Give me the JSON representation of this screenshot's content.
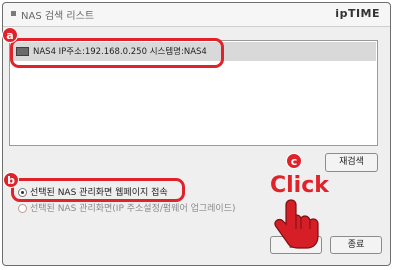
{
  "window": {
    "title": "NAS 검색 리스트",
    "brand": "ipTIME"
  },
  "nas_list": {
    "rows": [
      {
        "text": "NAS4  IP주소:192.168.0.250  시스템명:NAS4",
        "selected": true
      }
    ]
  },
  "buttons": {
    "rescan": "재검색",
    "run": "실행",
    "exit": "종료"
  },
  "options": {
    "open_web": {
      "label": "선택된 NAS 관리화면 웹페이지 접속",
      "selected": true
    },
    "assign_ip": {
      "label": "선택된 NAS 관리화면(IP 주소설정/펌웨어 업그레이드)",
      "selected": false
    }
  },
  "annotations": {
    "marker_a": "a",
    "marker_b": "b",
    "marker_c": "c",
    "click_text": "Click",
    "highlight_color": "#e0232a"
  }
}
